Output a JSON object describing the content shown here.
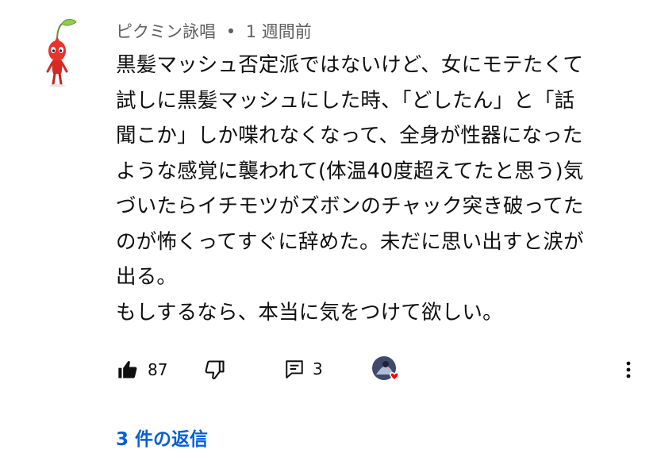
{
  "comment": {
    "author": "ピクミン詠唱",
    "separator": "•",
    "time": "1 週間前",
    "lines": [
      "黒髪マッシュ否定派ではないけど、女にモテたくて",
      "試しに黒髪マッシュにした時、「どしたん」と「話",
      "聞こか」しか喋れなくなって、全身が性器になった",
      "ような感覚に襲われて(体温40度超えてたと思う)気",
      "づいたらイチモツがズボンのチャック突き破ってた",
      "のが怖くってすぐに辞めた。未だに思い出すと涙が",
      "出る。",
      "もしするなら、本当に気をつけて欲しい。"
    ]
  },
  "actions": {
    "like_count": "87",
    "reply_count": "3",
    "like_icon": "thumbs-up-filled-icon",
    "dislike_icon": "thumbs-down-outline-icon",
    "reply_icon": "reply-comment-icon",
    "creator_heart_icon": "creator-heart-icon",
    "more_icon": "more-vertical-icon"
  },
  "replies": {
    "label": "3 件の返信"
  },
  "colors": {
    "text": "#0f0f0f",
    "meta": "#606060",
    "link": "#065fd4",
    "heart": "#ff0000",
    "pikmin_red": "#e8322b"
  }
}
